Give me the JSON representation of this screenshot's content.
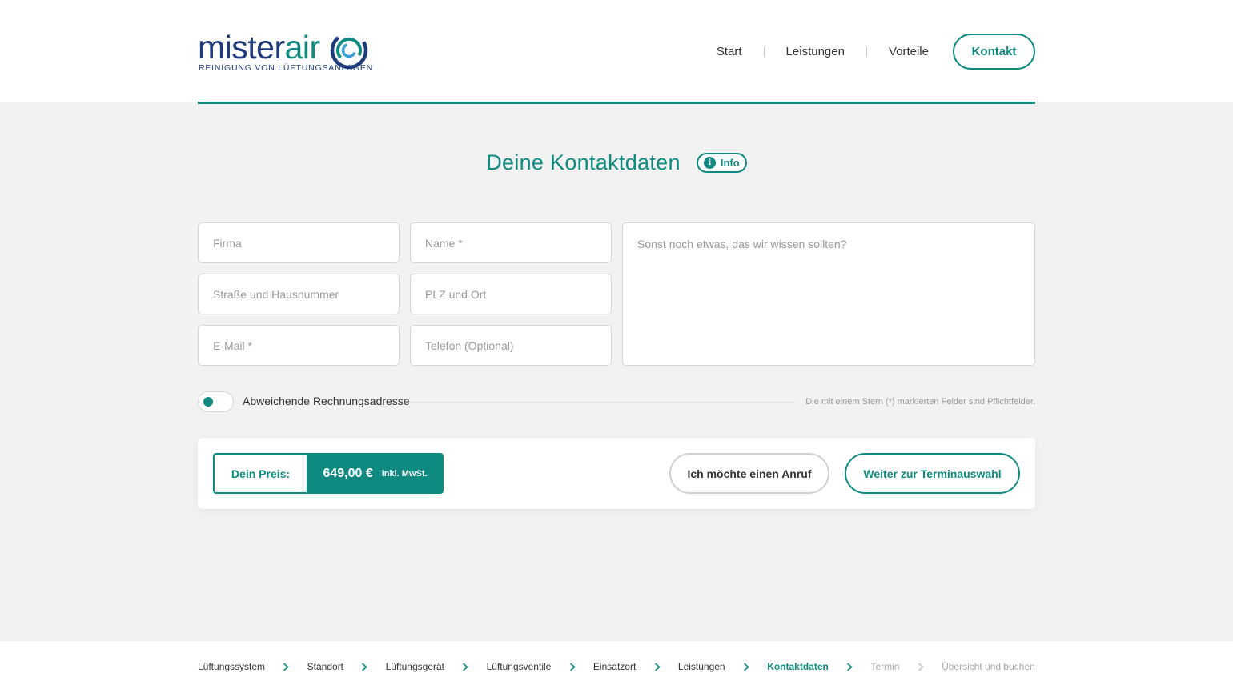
{
  "brand": {
    "name_part1": "mister",
    "name_part2": "air",
    "tagline": "REINIGUNG VON LÜFTUNGSANLAGEN",
    "primary_color": "#0e8a80",
    "secondary_color": "#1f3b7a"
  },
  "nav": {
    "items": [
      "Start",
      "Leistungen",
      "Vorteile"
    ],
    "cta": "Kontakt"
  },
  "page": {
    "title": "Deine Kontaktdaten",
    "info_label": "Info",
    "info_icon": "info-icon"
  },
  "form": {
    "company_placeholder": "Firma",
    "name_placeholder": "Name *",
    "street_placeholder": "Straße und Hausnummer",
    "zip_placeholder": "PLZ und Ort",
    "email_placeholder": "E-Mail *",
    "phone_placeholder": "Telefon (Optional)",
    "message_placeholder": "Sonst noch etwas, das wir wissen sollten?",
    "toggle_label": "Abweichende Rechnungsadresse",
    "toggle_on": false,
    "required_note": "Die mit einem Stern (*) markierten Felder sind Pflichtfelder."
  },
  "actions": {
    "price_label": "Dein Preis:",
    "price_value": "649,00 €",
    "price_tax": "inkl. MwSt.",
    "call_button": "Ich möchte einen Anruf",
    "next_button": "Weiter zur Terminauswahl"
  },
  "steps": [
    {
      "label": "Lüftungssystem",
      "state": "done"
    },
    {
      "label": "Standort",
      "state": "done"
    },
    {
      "label": "Lüftungsgerät",
      "state": "done"
    },
    {
      "label": "Lüftungsventile",
      "state": "done"
    },
    {
      "label": "Einsatzort",
      "state": "done"
    },
    {
      "label": "Leistungen",
      "state": "done"
    },
    {
      "label": "Kontaktdaten",
      "state": "active"
    },
    {
      "label": "Termin",
      "state": "future"
    },
    {
      "label": "Übersicht und buchen",
      "state": "future"
    }
  ]
}
